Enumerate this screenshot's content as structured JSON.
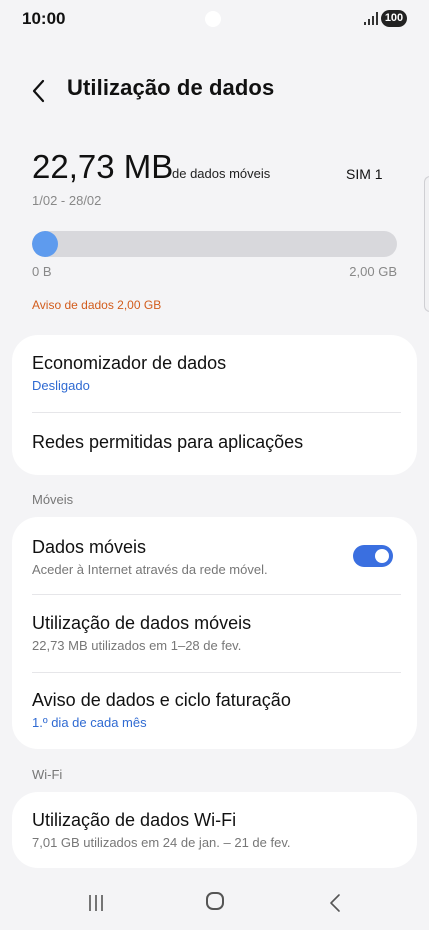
{
  "status_bar": {
    "time": "10:00",
    "battery": "100"
  },
  "header": {
    "title": "Utilização de dados"
  },
  "usage": {
    "amount": "22,73 MB",
    "unit_label": "de dados móveis",
    "sim": "SIM 1",
    "date_range": "1/02 - 28/02",
    "progress_fraction": 0.06,
    "min_label": "0 B",
    "max_label": "2,00 GB",
    "warning": "Aviso de dados 2,00 GB"
  },
  "card1": {
    "data_saver_title": "Economizador de dados",
    "data_saver_status": "Desligado",
    "allowed_networks": "Redes permitidas para aplicações"
  },
  "section_mobile": "Móveis",
  "card2": {
    "mobile_data_title": "Dados móveis",
    "mobile_data_sub": "Aceder à Internet através da rede móvel.",
    "mobile_data_on": true,
    "mobile_usage_title": "Utilização de dados móveis",
    "mobile_usage_sub": "22,73 MB utilizados em 1–28 de fev.",
    "warning_cycle_title": "Aviso de dados e ciclo faturação",
    "warning_cycle_sub": "1.º dia de cada mês"
  },
  "section_wifi": "Wi-Fi",
  "card3": {
    "wifi_usage_title": "Utilização de dados Wi-Fi",
    "wifi_usage_sub": "7,01 GB utilizados em 24 de jan. – 21 de fev."
  },
  "colors": {
    "accent": "#3a6fe0",
    "progress": "#5e9bee",
    "warning": "#d25c1c",
    "link": "#2f6ad2"
  }
}
